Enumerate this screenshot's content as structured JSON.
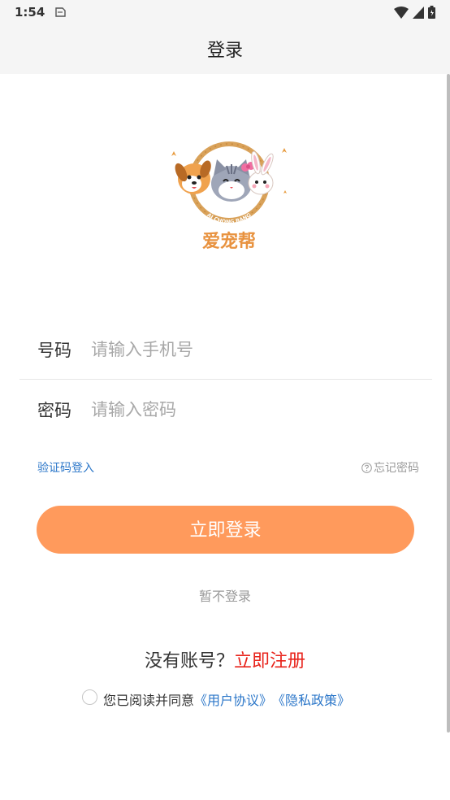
{
  "status_bar": {
    "time": "1:54"
  },
  "header": {
    "title": "登录"
  },
  "logo": {
    "brand_text": "爱宠帮",
    "ring_text": "AI CHONG BANG"
  },
  "form": {
    "phone": {
      "label": "号码",
      "placeholder": "请输入手机号"
    },
    "password": {
      "label": "密码",
      "placeholder": "请输入密码"
    }
  },
  "links": {
    "sms_login": "验证码登入",
    "forgot_password": "忘记密码"
  },
  "buttons": {
    "login": "立即登录",
    "skip": "暂不登录"
  },
  "register": {
    "question": "没有账号？",
    "action": "立即注册"
  },
  "agreement": {
    "prefix": "您已阅读并同意",
    "user_agreement": "《用户协议》",
    "privacy_policy": "《隐私政策》",
    "checked": false
  },
  "colors": {
    "accent": "#ff9a5c",
    "link": "#2c77c9",
    "register": "#e8231b",
    "header_bg": "#f5f5f5"
  }
}
